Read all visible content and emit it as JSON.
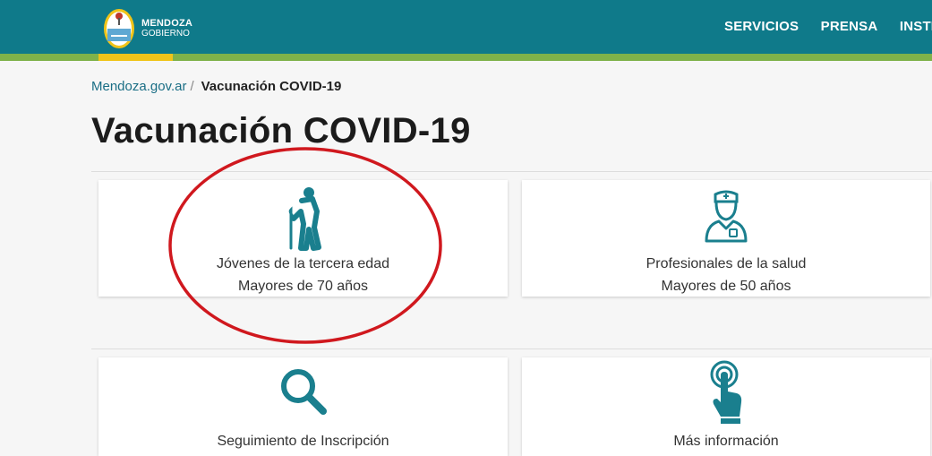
{
  "header": {
    "brand_line1": "MENDOZA",
    "brand_line2": "GOBIERNO",
    "nav": [
      "SERVICIOS",
      "PRENSA",
      "INSTIT"
    ]
  },
  "breadcrumb": {
    "home": "Mendoza.gov.ar",
    "separator": "/",
    "current": "Vacunación COVID-19"
  },
  "page_title": "Vacunación COVID-19",
  "cards": [
    {
      "icon": "elderly-person-icon",
      "line1": "Jóvenes de la tercera edad",
      "line2": "Mayores de 70 años"
    },
    {
      "icon": "nurse-icon",
      "line1": "Profesionales de la salud",
      "line2": "Mayores de 50 años"
    },
    {
      "icon": "magnifier-icon",
      "line1": "Seguimiento de Inscripción"
    },
    {
      "icon": "touch-hand-icon",
      "line1": "Más información"
    }
  ],
  "colors": {
    "header": "#0f7a8a",
    "accent_green": "#7fb24a",
    "accent_yellow": "#f0c419",
    "icon_teal": "#1a7f8e",
    "annotation_red": "#d0181e"
  }
}
